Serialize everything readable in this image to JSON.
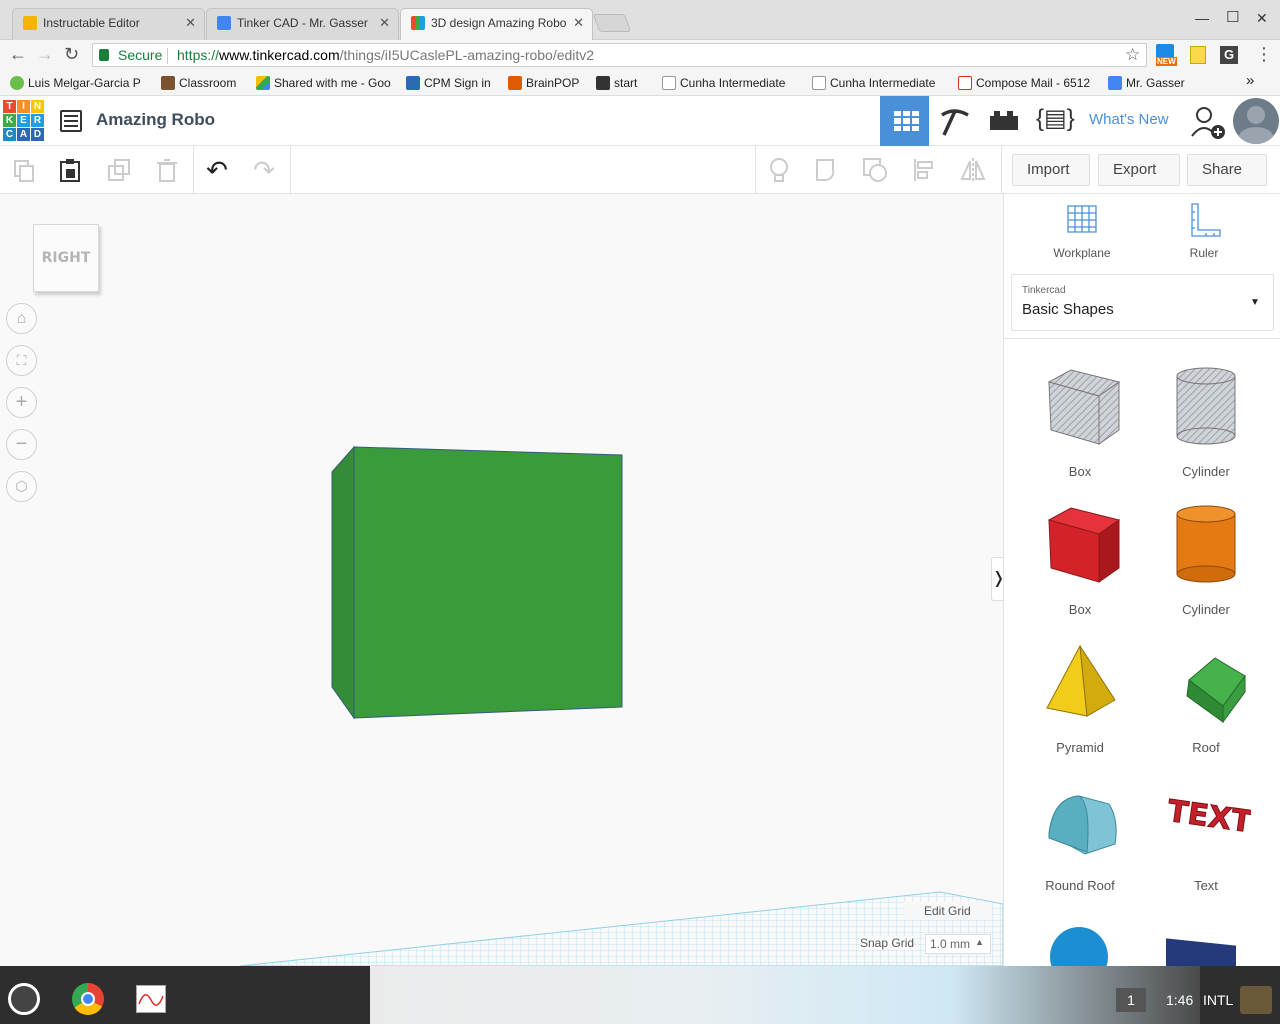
{
  "browser": {
    "tabs": [
      {
        "title": "Instructable Editor",
        "active": false,
        "favicon_color": "#f4b400"
      },
      {
        "title": "Tinker CAD - Mr. Gasser",
        "active": false,
        "favicon_color": "#4285f4"
      },
      {
        "title": "3D design Amazing Robo",
        "active": true,
        "favicon_color": "#e94235"
      }
    ],
    "secure_label": "Secure",
    "url_prefix": "https://",
    "url_host": "www.tinkercad.com",
    "url_path": "/things/iI5UCaslePL-amazing-robo/editv2",
    "ext_badge": "NEW",
    "bookmarks": [
      {
        "label": "Luis Melgar-Garcia P",
        "icon_color": "#6abf4b"
      },
      {
        "label": "Classroom",
        "icon_color": "#7a5230"
      },
      {
        "label": "Shared with me - Goo",
        "icon_color": "#fbbc04"
      },
      {
        "label": "CPM Sign in",
        "icon_color": "#2b6cb0"
      },
      {
        "label": "BrainPOP",
        "icon_color": "#e05a00"
      },
      {
        "label": "start",
        "icon_color": "#333333"
      },
      {
        "label": "Cunha Intermediate",
        "icon_color": "#9e9e9e"
      },
      {
        "label": "Cunha Intermediate",
        "icon_color": "#9e9e9e"
      },
      {
        "label": "Compose Mail - 6512",
        "icon_color": "#d93025"
      },
      {
        "label": "Mr. Gasser",
        "icon_color": "#4285f4"
      }
    ],
    "bookmarks_overflow": "»"
  },
  "app": {
    "logo_letters": [
      "T",
      "I",
      "N",
      "K",
      "E",
      "R",
      "C",
      "A",
      "D"
    ],
    "logo_colors": [
      "#e94b2c",
      "#f68e2c",
      "#fdc400",
      "#3fa944",
      "#1e9ee3",
      "#1e9ee3",
      "#1e88c9",
      "#2c68b5",
      "#2c68b5"
    ],
    "design_title": "Amazing Robo",
    "whats_new": "What's New",
    "accent": "#4a90d9",
    "import_label": "Import",
    "export_label": "Export",
    "share_label": "Share"
  },
  "viewcube": {
    "face_label": "RIGHT"
  },
  "canvas": {
    "object_color": "#3a9b3c",
    "object_side_color": "#358c37",
    "edit_grid_label": "Edit Grid",
    "snap_grid_label": "Snap Grid",
    "snap_grid_value": "1.0 mm"
  },
  "panel": {
    "workplane_label": "Workplane",
    "ruler_label": "Ruler",
    "library_caption": "Tinkercad",
    "library_name": "Basic Shapes",
    "collapse_glyph": "❭",
    "shapes": [
      {
        "label": "Box",
        "icon": "box-hole-icon"
      },
      {
        "label": "Cylinder",
        "icon": "cylinder-hole-icon"
      },
      {
        "label": "Box",
        "icon": "box-red-icon"
      },
      {
        "label": "Cylinder",
        "icon": "cylinder-orange-icon"
      },
      {
        "label": "Pyramid",
        "icon": "pyramid-icon"
      },
      {
        "label": "Roof",
        "icon": "roof-icon"
      },
      {
        "label": "Round Roof",
        "icon": "round-roof-icon"
      },
      {
        "label": "Text",
        "icon": "text-shape-icon"
      }
    ]
  },
  "taskbar": {
    "workspace_number": "1",
    "clock": "1:46",
    "input_method": "INTL"
  }
}
